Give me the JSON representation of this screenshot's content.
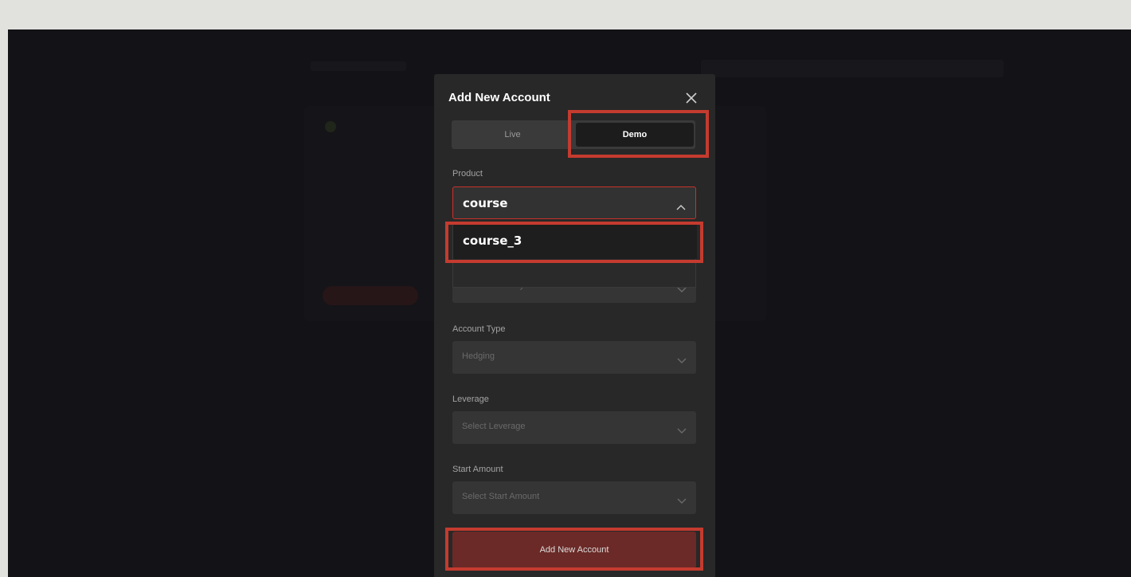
{
  "modal": {
    "title": "Add New Account",
    "tabs": [
      {
        "label": "Live",
        "selected": false
      },
      {
        "label": "Demo",
        "selected": true
      }
    ],
    "product": {
      "label": "Product",
      "value": "course",
      "options": [
        "course_3"
      ]
    },
    "currency": {
      "placeholder": "Select Currency"
    },
    "account_type": {
      "label": "Account Type",
      "value": "Hedging"
    },
    "leverage": {
      "label": "Leverage",
      "placeholder": "Select Leverage"
    },
    "start_amount": {
      "label": "Start Amount",
      "placeholder": "Select Start Amount"
    },
    "submit_label": "Add New Account"
  },
  "icons": {
    "close": "close-icon",
    "chevron_up": "chevron-up-icon",
    "chevron_down": "chevron-down-icon"
  },
  "colors": {
    "highlight": "#c43b2f",
    "submit": "#6b2a27",
    "modal_bg": "#282828",
    "page_bg": "#131216"
  }
}
